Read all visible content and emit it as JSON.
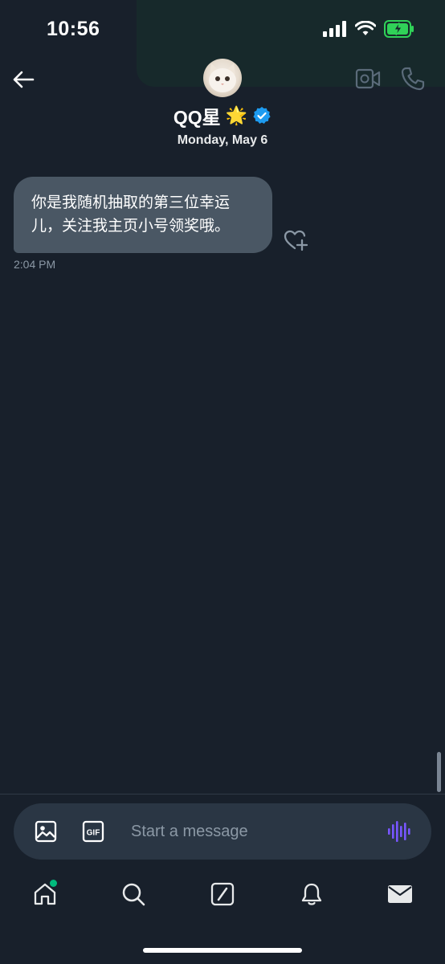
{
  "status_bar": {
    "time": "10:56",
    "icons": [
      "signal-icon",
      "wifi-icon",
      "battery-charging-icon"
    ],
    "battery_color": "#30d158"
  },
  "header": {
    "back_icon": "arrow-left-icon",
    "name": "QQ星",
    "name_emoji": "🌟",
    "verified_color": "#1d9bf0",
    "date": "Monday, May 6",
    "actions": [
      "video-call-icon",
      "phone-icon"
    ]
  },
  "messages": [
    {
      "text": "你是我随机抽取的第三位幸运儿，关注我主页小号领奖哦。",
      "time": "2:04 PM",
      "reaction_icon": "heart-plus-icon"
    }
  ],
  "composer": {
    "placeholder": "Start a message",
    "value": "",
    "buttons": [
      "image-icon",
      "gif-icon",
      "voice-icon"
    ],
    "gif_label": "GIF",
    "voice_color": "#7856ff"
  },
  "tabbar": {
    "items": [
      "home-icon",
      "search-icon",
      "grok-icon",
      "bell-icon",
      "mail-icon"
    ],
    "home_badge_color": "#00ba7c"
  },
  "colors": {
    "background": "#18202b",
    "bubble": "#4a5764",
    "composer": "#2a3644",
    "muted_text": "#8b98a5"
  }
}
